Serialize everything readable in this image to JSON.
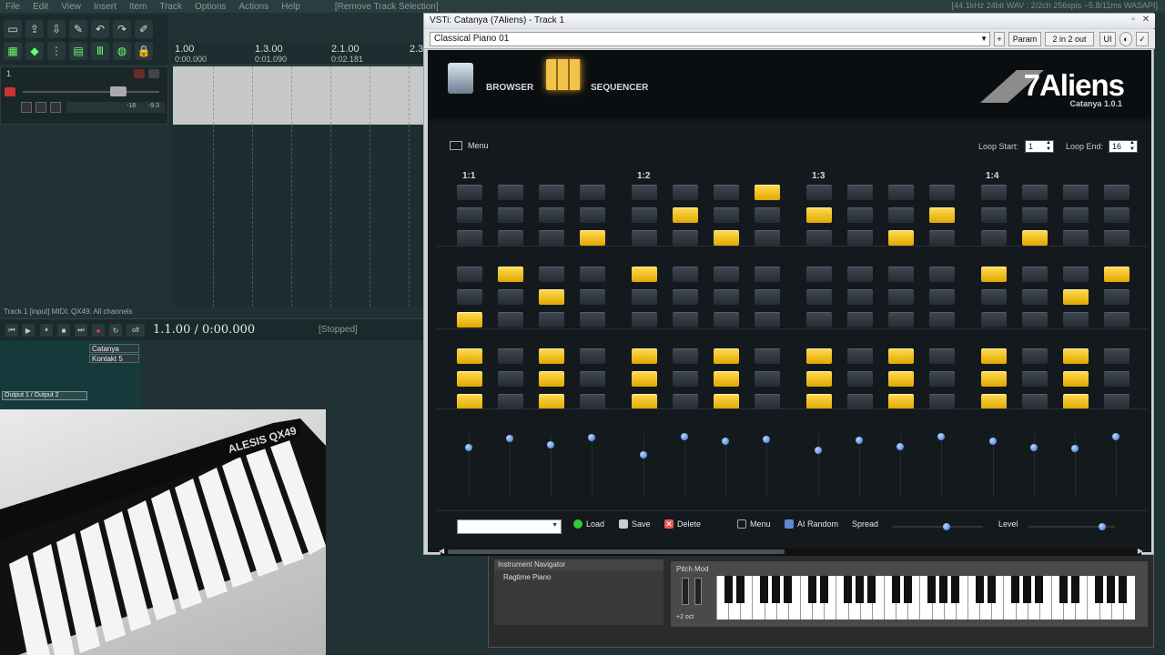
{
  "menubar": {
    "items": [
      "File",
      "Edit",
      "View",
      "Insert",
      "Item",
      "Track",
      "Options",
      "Actions",
      "Help",
      "[Remove Track Selection]"
    ],
    "audio_status": "[44.1kHz 24bit WAV : 2/2ch 256spls ~5.8/11ms WASAPI]"
  },
  "ruler": {
    "marks": [
      {
        "bar": "1.00",
        "time": "0:00.000"
      },
      {
        "bar": "1.3.00",
        "time": "0:01.090"
      },
      {
        "bar": "2.1.00",
        "time": "0:02.181"
      },
      {
        "bar": "2.3",
        "time": ""
      }
    ]
  },
  "track": {
    "number": "1",
    "meter_left": "-18",
    "meter_right": "-9.3",
    "info": "Track 1 [input] MIDI: QX49: All channels"
  },
  "transport": {
    "position": "1.1.00 / 0:00.000",
    "status": "[Stopped]",
    "off_label": "off"
  },
  "mixer": {
    "fx": [
      "Catanya",
      "Kontakt 5"
    ],
    "output": "Output 1 / Output 2"
  },
  "plugin": {
    "title": "VSTi: Catanya (7Aliens) - Track 1",
    "preset": "Classical Piano 01",
    "buttons": {
      "plus": "+",
      "param": "Param",
      "io": "2 in 2 out",
      "ui": "UI"
    },
    "nav": {
      "browser": "BROWSER",
      "sequencer": "SEQUENCER"
    },
    "logo": {
      "brand": "7Aliens",
      "product": "Catanya 1.0.1"
    },
    "menu_label": "Menu",
    "loop": {
      "start_label": "Loop Start:",
      "start_value": "1",
      "end_label": "Loop End:",
      "end_value": "16"
    },
    "beats": [
      "1:1",
      "1:2",
      "1:3",
      "1:4"
    ],
    "grid": [
      [
        0,
        0,
        0,
        0,
        0,
        0,
        0,
        1,
        0,
        0,
        0,
        0,
        0,
        0,
        0,
        0
      ],
      [
        0,
        0,
        0,
        0,
        0,
        1,
        0,
        0,
        1,
        0,
        0,
        1,
        0,
        0,
        0,
        0
      ],
      [
        0,
        0,
        0,
        1,
        0,
        0,
        1,
        0,
        0,
        0,
        1,
        0,
        0,
        1,
        0,
        0
      ],
      [
        0,
        1,
        0,
        0,
        1,
        0,
        0,
        0,
        0,
        0,
        0,
        0,
        1,
        0,
        0,
        1
      ],
      [
        0,
        0,
        1,
        0,
        0,
        0,
        0,
        0,
        0,
        0,
        0,
        0,
        0,
        0,
        1,
        0
      ],
      [
        1,
        0,
        0,
        0,
        0,
        0,
        0,
        0,
        0,
        0,
        0,
        0,
        0,
        0,
        0,
        0
      ],
      [
        1,
        0,
        1,
        0,
        1,
        0,
        1,
        0,
        1,
        0,
        1,
        0,
        1,
        0,
        1,
        0
      ],
      [
        1,
        0,
        1,
        0,
        1,
        0,
        1,
        0,
        1,
        0,
        1,
        0,
        1,
        0,
        1,
        0
      ],
      [
        1,
        0,
        1,
        0,
        1,
        0,
        1,
        0,
        1,
        0,
        1,
        0,
        1,
        0,
        1,
        0
      ]
    ],
    "velocities": [
      0.3,
      0.5,
      0.36,
      0.53,
      0.14,
      0.55,
      0.45,
      0.48,
      0.25,
      0.47,
      0.32,
      0.54,
      0.45,
      0.3,
      0.29,
      0.55
    ],
    "bottom": {
      "load": "Load",
      "save": "Save",
      "delete": "Delete",
      "menu": "Menu",
      "ai_random": "AI Random",
      "spread": "Spread",
      "level": "Level"
    },
    "spread_value": 0.6,
    "level_value": 0.85
  },
  "navigator": {
    "title": "Instrument Navigator",
    "item": "Ragtime Piano",
    "pitch_label": "Pitch Mod",
    "octave": "+2 oct"
  },
  "webcam": {
    "brand": "ALESIS QX49"
  }
}
